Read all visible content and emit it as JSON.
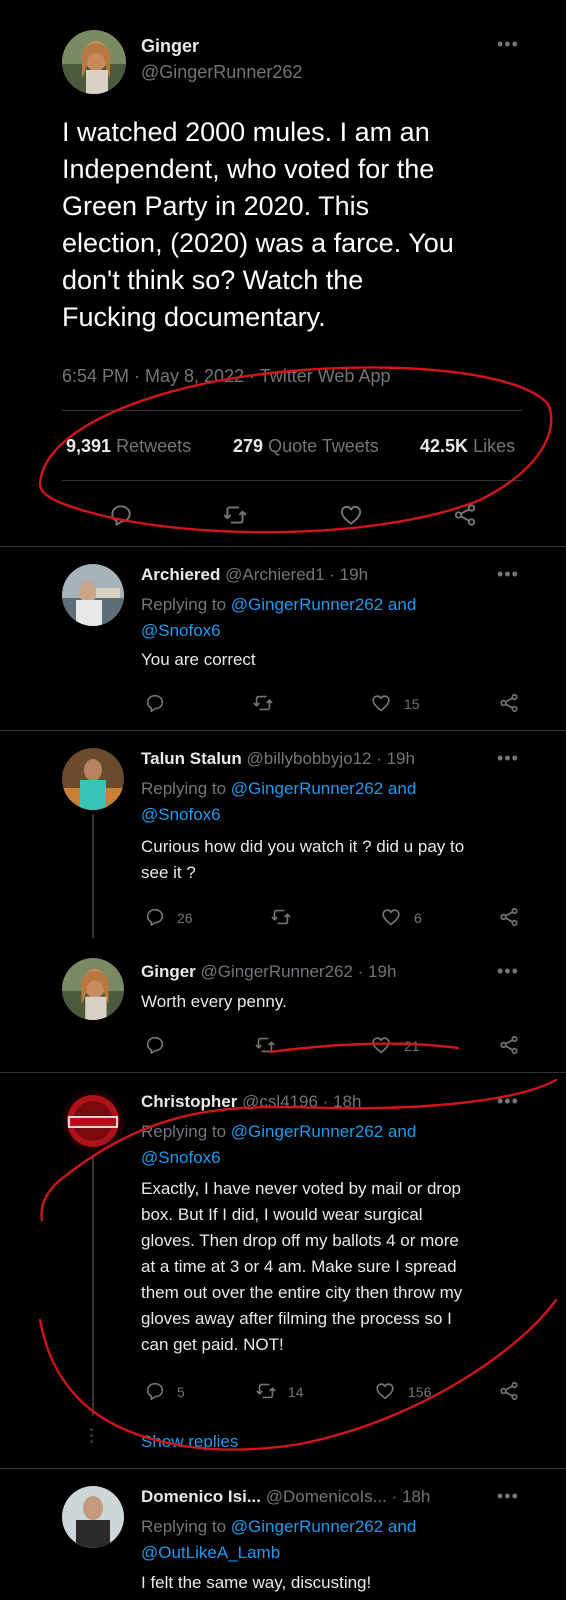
{
  "main_tweet": {
    "name": "Ginger",
    "handle": "@GingerRunner262",
    "text_lines": [
      "I watched 2000 mules. I am an",
      "Independent, who voted for the",
      "Green Party in 2020. This",
      "election, (2020) was a farce. You",
      "don't think so? Watch the",
      "Fucking documentary."
    ],
    "meta": "6:54 PM · May 8, 2022 · Twitter Web App",
    "retweets_count": "9,391",
    "retweets_label": "Retweets",
    "quotes_count": "279",
    "quotes_label": "Quote Tweets",
    "likes_count": "42.5K",
    "likes_label": "Likes"
  },
  "replies": [
    {
      "name": "Archiered",
      "handle_time": "@Archiered1 · 19h",
      "replying_prefix": "Replying to",
      "replying_line1": "@GingerRunner262 and",
      "replying_line2": "@Snofox6",
      "text_lines": [
        "You are correct"
      ],
      "reply_count": "",
      "retweet_count": "",
      "like_count": "15"
    },
    {
      "name": "Talun Stalun",
      "handle_time": "@billybobbyjo12 · 19h",
      "replying_prefix": "Replying to",
      "replying_line1": "@GingerRunner262 and",
      "replying_line2": "@Snofox6",
      "text_lines": [
        "Curious how did you watch it ? did u pay to",
        "see it ?"
      ],
      "reply_count": "26",
      "retweet_count": "",
      "like_count": "6"
    },
    {
      "name": "Ginger",
      "handle_time": "@GingerRunner262 · 19h",
      "text_lines": [
        "Worth every penny."
      ],
      "reply_count": "",
      "retweet_count": "",
      "like_count": "21"
    },
    {
      "name": "Christopher",
      "handle_time": "@csl4196 · 18h",
      "replying_prefix": "Replying to",
      "replying_line1": "@GingerRunner262 and",
      "replying_line2": "@Snofox6",
      "text_lines": [
        "Exactly, I have never voted by mail or drop",
        "box. But If I did, I would wear surgical",
        "gloves. Then drop off my ballots 4 or more",
        "at a time at 3 or 4 am. Make sure I spread",
        "them out over the entire city then throw my",
        "gloves away after filming the process so I",
        "can get paid. NOT!"
      ],
      "reply_count": "5",
      "retweet_count": "14",
      "like_count": "156",
      "show_replies": "Show replies"
    },
    {
      "name": "Domenico Isi...",
      "handle_time": "@DomenicoIs... · 18h",
      "replying_prefix": "Replying to",
      "replying_line1": "@GingerRunner262 and",
      "replying_line2": "@OutLikeA_Lamb",
      "text_lines": [
        "I felt the same way, discusting!"
      ]
    }
  ],
  "icons": {
    "reply": "reply-icon",
    "retweet": "retweet-icon",
    "like": "heart-icon",
    "share": "share-icon",
    "more": "more-icon"
  },
  "colors": {
    "background": "#000000",
    "text": "#e7e9ea",
    "muted": "#71767b",
    "link": "#1d9bf0",
    "annotation": "#d0161b"
  }
}
